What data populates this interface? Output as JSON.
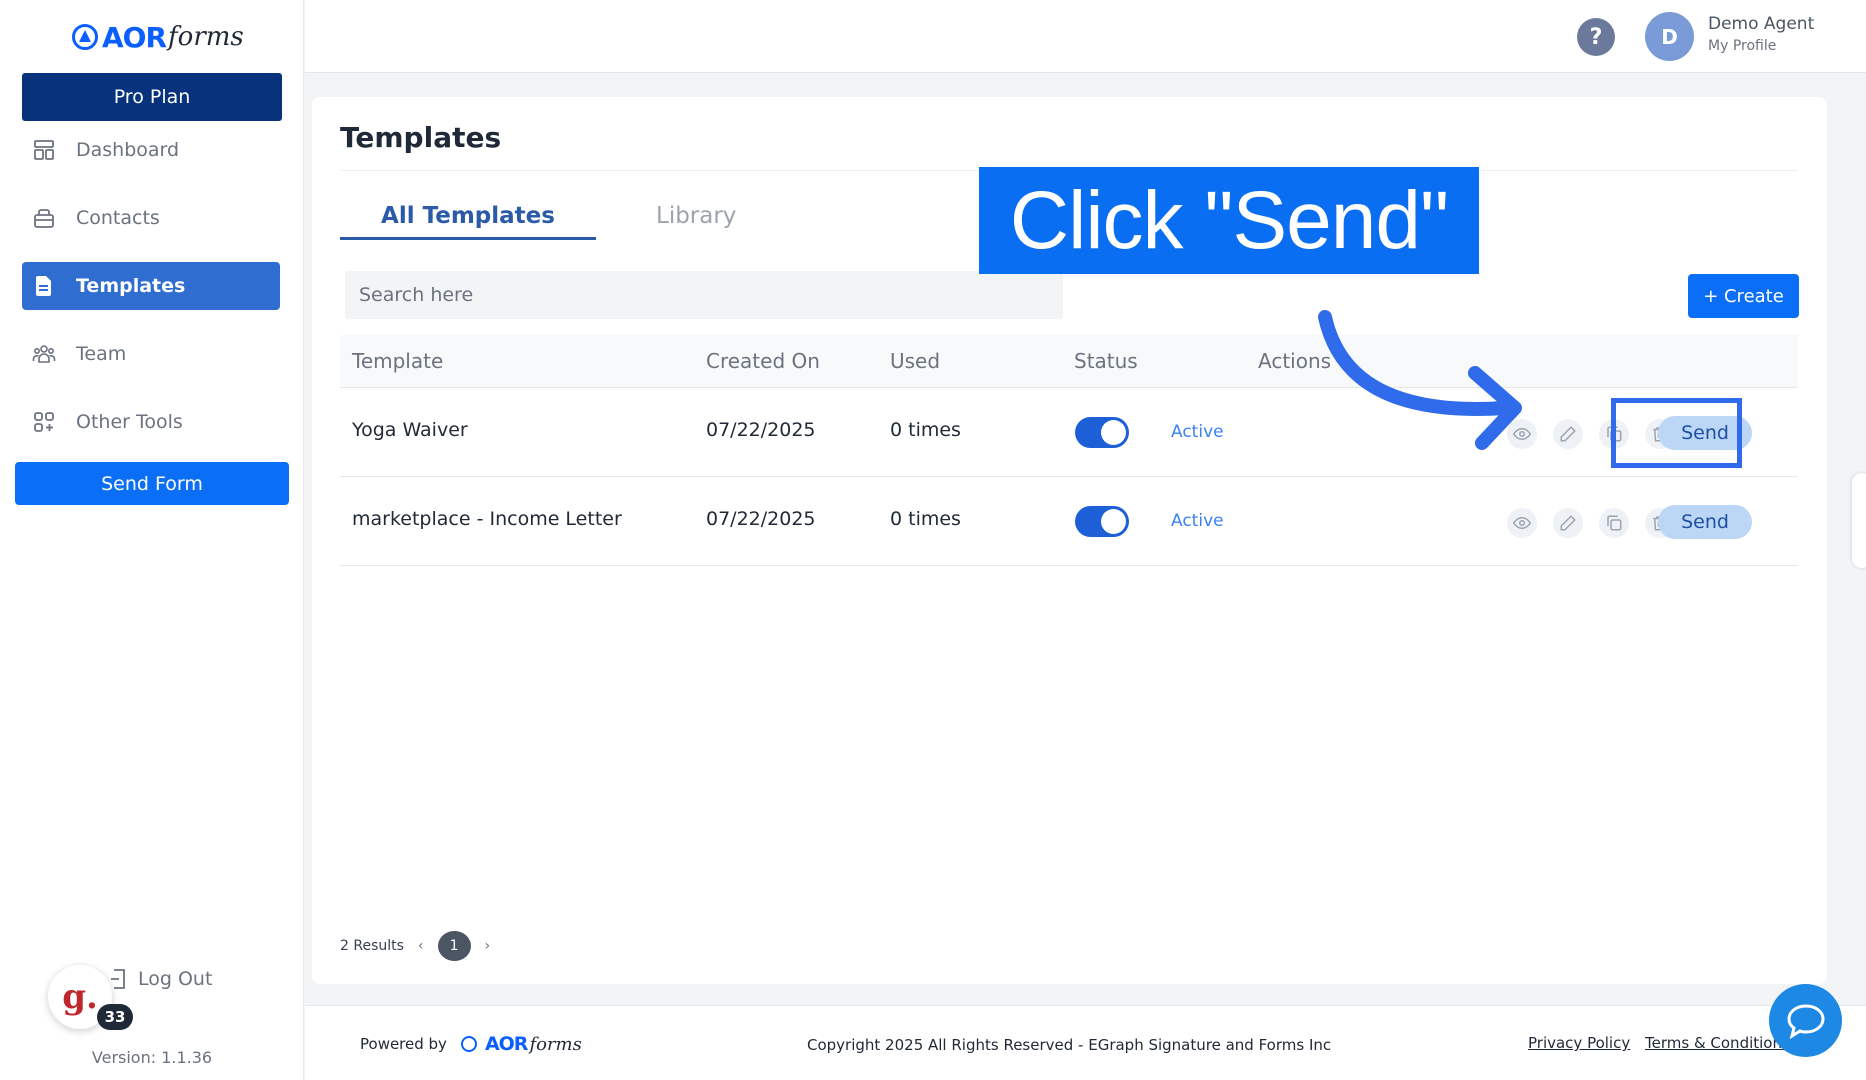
{
  "brand": {
    "aor": "AOR",
    "forms": "forms"
  },
  "sidebar": {
    "plan_label": "Pro Plan",
    "items": [
      {
        "label": "Dashboard",
        "icon": "dashboard-icon"
      },
      {
        "label": "Contacts",
        "icon": "contacts-icon"
      },
      {
        "label": "Templates",
        "icon": "templates-icon",
        "active": true
      },
      {
        "label": "Team",
        "icon": "team-icon"
      },
      {
        "label": "Other Tools",
        "icon": "other-tools-icon"
      }
    ],
    "send_form_label": "Send Form",
    "logout_label": "Log Out",
    "version": "Version: 1.1.36",
    "g_badge": {
      "letter": "g.",
      "count": "33"
    }
  },
  "header": {
    "help": "?",
    "avatar_initial": "D",
    "profile_name": "Demo Agent",
    "profile_sub": "My Profile"
  },
  "main": {
    "title": "Templates",
    "tabs": [
      {
        "label": "All Templates",
        "active": true
      },
      {
        "label": "Library",
        "active": false
      }
    ],
    "search_placeholder": "Search here",
    "create_label": "+ Create",
    "columns": [
      "Template",
      "Created On",
      "Used",
      "Status",
      "Actions"
    ],
    "rows": [
      {
        "name": "Yoga Waiver",
        "created": "07/22/2025",
        "used": "0 times",
        "status": "Active",
        "send": "Send"
      },
      {
        "name": "marketplace - Income Letter",
        "created": "07/22/2025",
        "used": "0 times",
        "status": "Active",
        "send": "Send"
      }
    ],
    "pagination": {
      "results": "2 Results",
      "page": "1",
      "prev": "‹",
      "next": "›"
    }
  },
  "footer": {
    "powered_by": "Powered by",
    "copyright": "Copyright 2025 All Rights Reserved - EGraph Signature and Forms Inc",
    "privacy": "Privacy Policy",
    "terms": "Terms & Conditions"
  },
  "annotation": {
    "callout": "Click \"Send\""
  },
  "colors": {
    "primary": "#0b6ef6",
    "plan": "#08337c",
    "active_nav": "#2f6dd1",
    "send_pill": "#bcd7f5",
    "status_text": "#3b82f6"
  }
}
